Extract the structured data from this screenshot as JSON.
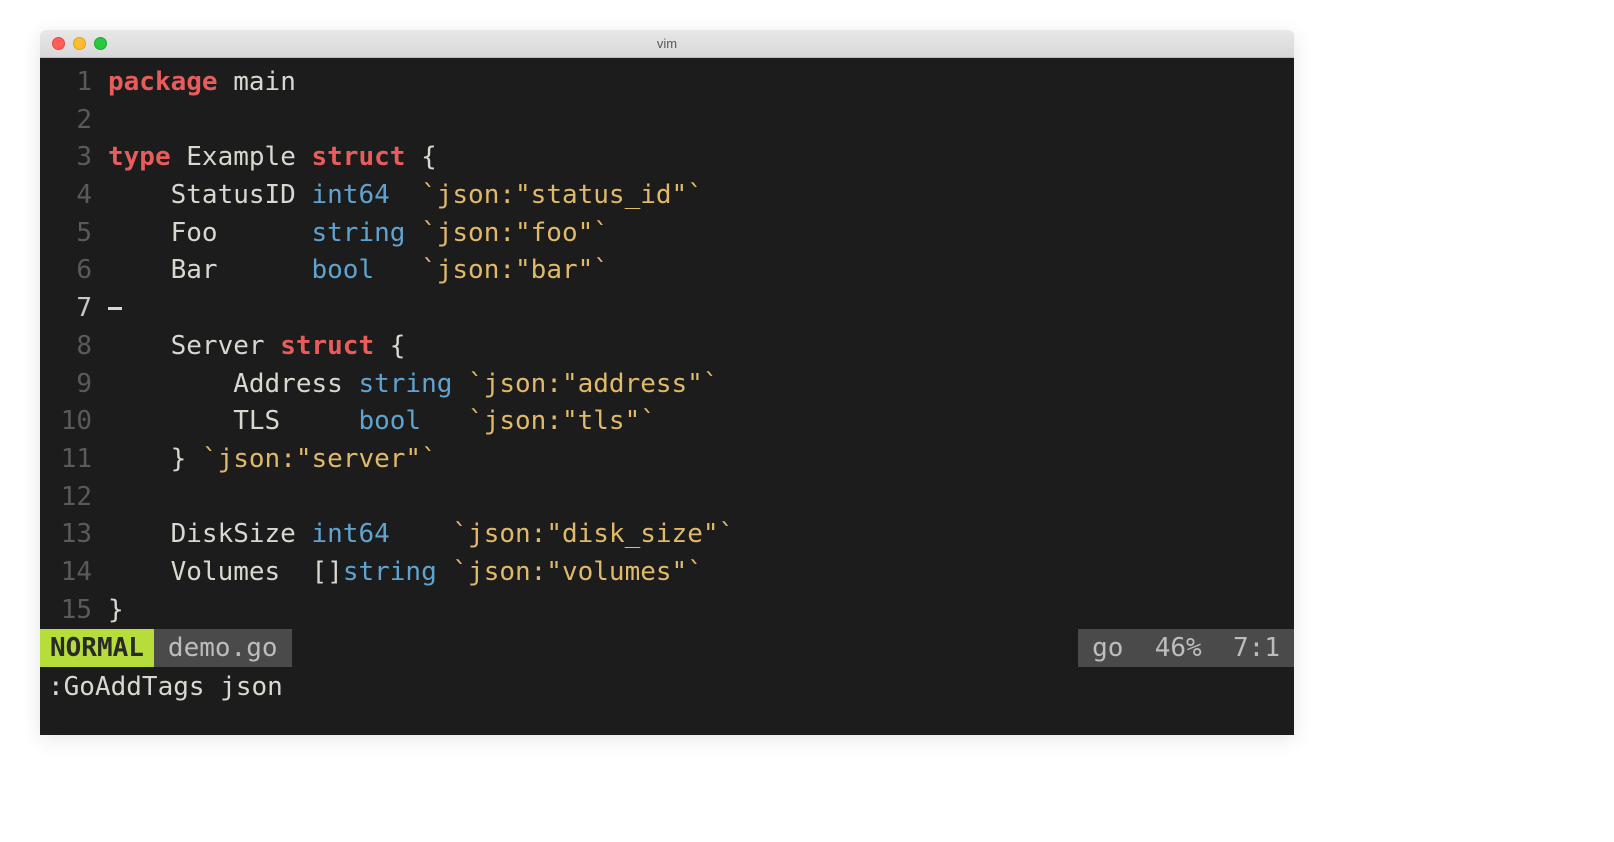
{
  "window": {
    "title": "vim"
  },
  "code": {
    "lines": [
      {
        "num": "1",
        "tokens": [
          [
            "kw",
            "package "
          ],
          [
            "ident",
            "main"
          ]
        ]
      },
      {
        "num": "2",
        "tokens": []
      },
      {
        "num": "3",
        "tokens": [
          [
            "kw",
            "type "
          ],
          [
            "ident",
            "Example "
          ],
          [
            "kw",
            "struct "
          ],
          [
            "punct",
            "{"
          ]
        ]
      },
      {
        "num": "4",
        "tokens": [
          [
            "ident",
            "    StatusID "
          ],
          [
            "typ",
            "int64"
          ],
          [
            "ident",
            "  "
          ],
          [
            "tag",
            "`json:\"status_id\"`"
          ]
        ]
      },
      {
        "num": "5",
        "tokens": [
          [
            "ident",
            "    Foo      "
          ],
          [
            "typ",
            "string"
          ],
          [
            "ident",
            " "
          ],
          [
            "tag",
            "`json:\"foo\"`"
          ]
        ]
      },
      {
        "num": "6",
        "tokens": [
          [
            "ident",
            "    Bar      "
          ],
          [
            "typ",
            "bool"
          ],
          [
            "ident",
            "   "
          ],
          [
            "tag",
            "`json:\"bar\"`"
          ]
        ]
      },
      {
        "num": "7",
        "tokens": [],
        "cursor": true
      },
      {
        "num": "8",
        "tokens": [
          [
            "ident",
            "    Server "
          ],
          [
            "kw",
            "struct "
          ],
          [
            "punct",
            "{"
          ]
        ]
      },
      {
        "num": "9",
        "tokens": [
          [
            "ident",
            "        Address "
          ],
          [
            "typ",
            "string"
          ],
          [
            "ident",
            " "
          ],
          [
            "tag",
            "`json:\"address\"`"
          ]
        ]
      },
      {
        "num": "10",
        "tokens": [
          [
            "ident",
            "        TLS     "
          ],
          [
            "typ",
            "bool"
          ],
          [
            "ident",
            "   "
          ],
          [
            "tag",
            "`json:\"tls\"`"
          ]
        ]
      },
      {
        "num": "11",
        "tokens": [
          [
            "ident",
            "    "
          ],
          [
            "punct",
            "}"
          ],
          [
            "ident",
            " "
          ],
          [
            "tag",
            "`json:\"server\"`"
          ]
        ]
      },
      {
        "num": "12",
        "tokens": []
      },
      {
        "num": "13",
        "tokens": [
          [
            "ident",
            "    DiskSize "
          ],
          [
            "typ",
            "int64"
          ],
          [
            "ident",
            "    "
          ],
          [
            "tag",
            "`json:\"disk_size\"`"
          ]
        ]
      },
      {
        "num": "14",
        "tokens": [
          [
            "ident",
            "    Volumes  []"
          ],
          [
            "typ",
            "string"
          ],
          [
            "ident",
            " "
          ],
          [
            "tag",
            "`json:\"volumes\"`"
          ]
        ]
      },
      {
        "num": "15",
        "tokens": [
          [
            "punct",
            "}"
          ]
        ]
      }
    ],
    "current_line": "7"
  },
  "status": {
    "mode": "NORMAL",
    "filename": "demo.go",
    "filetype": "go",
    "percent": "46%",
    "position": "7:1"
  },
  "command": ":GoAddTags json"
}
